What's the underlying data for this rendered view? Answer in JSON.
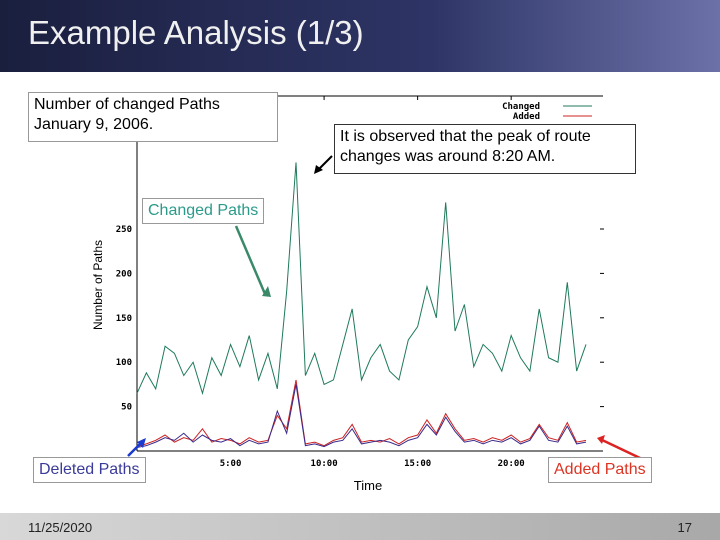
{
  "slide": {
    "title": "Example Analysis (1/3)",
    "date": "11/25/2020",
    "page": "17"
  },
  "callouts": {
    "header_line1": "Number of changed Paths",
    "header_line2": "January 9, 2006.",
    "peak_line1": "It is observed that the peak of route",
    "peak_line2": "changes was around 8:20 AM.",
    "changed": "Changed Paths",
    "deleted": "Deleted Paths",
    "added": "Added Paths"
  },
  "colors": {
    "changed": "#1f7a5a",
    "added": "#cc2222",
    "deleted": "#3a2a8a",
    "changed_label": "#2a9a8a",
    "deleted_label": "#3a3a9a",
    "added_label": "#dd3322"
  },
  "chart_data": {
    "type": "line",
    "xlabel": "Time",
    "ylabel": "Number of Paths",
    "xlim": [
      "0:00",
      "24:00"
    ],
    "ylim": [
      0,
      330
    ],
    "xticks": [
      "5:00",
      "10:00",
      "15:00",
      "20:00"
    ],
    "yticks": [
      "50",
      "100",
      "150",
      "200",
      "250"
    ],
    "legend": {
      "placement": "top-right",
      "entries": [
        "Changed",
        "Added"
      ]
    },
    "x": [
      "0:00",
      "0:30",
      "1:00",
      "1:30",
      "2:00",
      "2:30",
      "3:00",
      "3:30",
      "4:00",
      "4:30",
      "5:00",
      "5:30",
      "6:00",
      "6:30",
      "7:00",
      "7:30",
      "8:00",
      "8:30",
      "9:00",
      "9:30",
      "10:00",
      "10:30",
      "11:00",
      "11:30",
      "12:00",
      "12:30",
      "13:00",
      "13:30",
      "14:00",
      "14:30",
      "15:00",
      "15:30",
      "16:00",
      "16:30",
      "17:00",
      "17:30",
      "18:00",
      "18:30",
      "19:00",
      "19:30",
      "20:00",
      "20:30",
      "21:00",
      "21:30",
      "22:00",
      "22:30",
      "23:00",
      "23:30",
      "24:00"
    ],
    "series": [
      {
        "name": "Changed",
        "values": [
          65,
          88,
          70,
          118,
          110,
          85,
          100,
          65,
          105,
          85,
          120,
          95,
          130,
          80,
          110,
          70,
          180,
          325,
          85,
          110,
          75,
          80,
          120,
          160,
          80,
          105,
          120,
          90,
          80,
          125,
          140,
          185,
          150,
          280,
          135,
          165,
          95,
          120,
          110,
          90,
          130,
          105,
          90,
          160,
          105,
          100,
          190,
          90,
          120
        ]
      },
      {
        "name": "Added",
        "values": [
          5,
          8,
          12,
          18,
          10,
          15,
          12,
          25,
          10,
          14,
          12,
          8,
          15,
          10,
          12,
          40,
          25,
          80,
          8,
          10,
          6,
          12,
          15,
          30,
          10,
          12,
          10,
          14,
          8,
          15,
          18,
          35,
          20,
          42,
          25,
          12,
          14,
          10,
          15,
          12,
          18,
          10,
          14,
          30,
          15,
          12,
          32,
          10,
          12
        ]
      },
      {
        "name": "Deleted",
        "values": [
          4,
          6,
          10,
          15,
          12,
          20,
          10,
          18,
          12,
          10,
          14,
          6,
          12,
          8,
          10,
          45,
          20,
          75,
          6,
          8,
          5,
          10,
          12,
          25,
          8,
          10,
          12,
          10,
          6,
          12,
          15,
          30,
          18,
          38,
          22,
          10,
          12,
          8,
          12,
          10,
          15,
          8,
          12,
          28,
          12,
          10,
          28,
          8,
          10
        ]
      }
    ]
  }
}
